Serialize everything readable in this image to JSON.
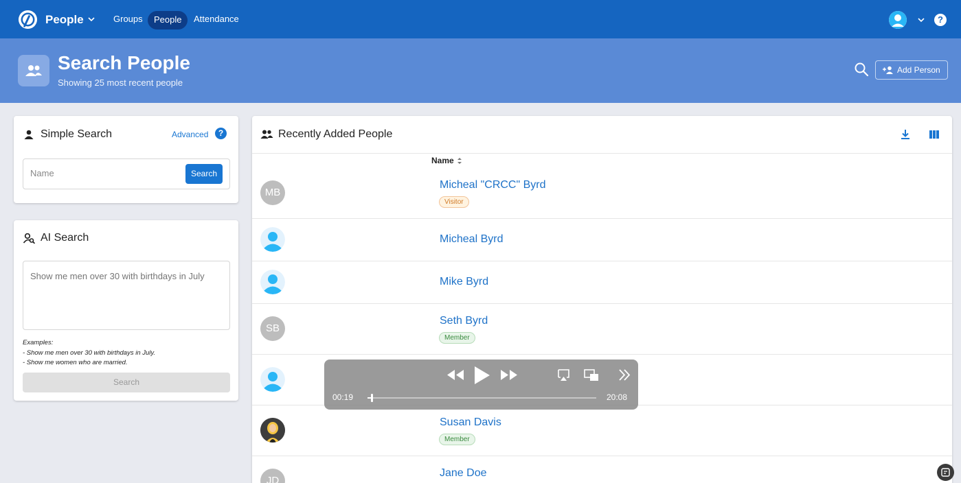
{
  "topbar": {
    "app_title": "People",
    "nav": [
      {
        "label": "Groups",
        "active": false
      },
      {
        "label": "People",
        "active": true
      },
      {
        "label": "Attendance",
        "active": false
      }
    ],
    "help_label": "?"
  },
  "header": {
    "title": "Search People",
    "subtitle": "Showing 25 most recent people",
    "add_person_label": "Add Person"
  },
  "simple_search": {
    "title": "Simple Search",
    "advanced_label": "Advanced",
    "help_label": "?",
    "name_placeholder": "Name",
    "name_value": "",
    "search_label": "Search"
  },
  "ai_search": {
    "title": "AI Search",
    "placeholder": "Show me men over 30 with birthdays in July",
    "examples_title": "Examples:",
    "examples": [
      "- Show me men over 30 with birthdays in July.",
      "- Show me women who are married."
    ],
    "search_label": "Search"
  },
  "people_list": {
    "title": "Recently Added People",
    "column_name": "Name",
    "rows": [
      {
        "name": "Micheal \"CRCC\" Byrd",
        "initials": "MB",
        "badge": "Visitor",
        "badge_type": "visitor",
        "avatar": "initials"
      },
      {
        "name": "Micheal Byrd",
        "initials": "",
        "badge": "",
        "badge_type": "",
        "avatar": "default"
      },
      {
        "name": "Mike Byrd",
        "initials": "",
        "badge": "",
        "badge_type": "",
        "avatar": "default"
      },
      {
        "name": "Seth Byrd",
        "initials": "SB",
        "badge": "Member",
        "badge_type": "member",
        "avatar": "initials"
      },
      {
        "name": "",
        "initials": "",
        "badge": "",
        "badge_type": "",
        "avatar": "default"
      },
      {
        "name": "Susan Davis",
        "initials": "",
        "badge": "Member",
        "badge_type": "member",
        "avatar": "photo"
      },
      {
        "name": "Jane Doe",
        "initials": "JD",
        "badge": "",
        "badge_type": "",
        "avatar": "initials"
      }
    ]
  },
  "video_player": {
    "elapsed": "00:19",
    "total": "20:08",
    "progress": 0.016
  },
  "colors": {
    "nav_bg": "#1565c0",
    "header_bg": "#5a8ad6",
    "link": "#1e72c8",
    "accent": "#1976d2"
  }
}
